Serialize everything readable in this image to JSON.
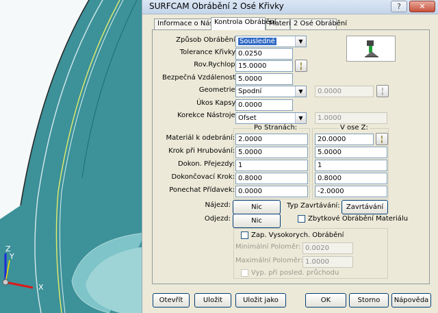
{
  "window": {
    "title": "SURFCAM Obrábění 2 Osé Křivky",
    "close_symbol": "✕",
    "help_symbol": "?"
  },
  "tabs": [
    {
      "label": "Informace o Nástroji"
    },
    {
      "label": "Kontrola Obrábění"
    },
    {
      "label": "Materiál"
    },
    {
      "label": "2 Osé Obrábění"
    }
  ],
  "form": {
    "zpusob": {
      "label": "Způsob Obrábění:",
      "value": "Sousledné"
    },
    "tolerance": {
      "label": "Tolerance Křivky:",
      "value": "0.0250"
    },
    "rov_rychlop": {
      "label": "Rov.Rychlop:",
      "value": "15.0000"
    },
    "bezpecna": {
      "label": "Bezpečná Vzdálenost:",
      "value": "5.0000"
    },
    "geometrie": {
      "label": "Geometrie:",
      "value": "Spodní",
      "side_value": "0.0000"
    },
    "ukos": {
      "label": "Úkos Kapsy:",
      "value": "0.0000"
    },
    "korekce": {
      "label": "Korekce Nástroje:",
      "value": "Ofset",
      "side_value": "1.0000"
    }
  },
  "grid": {
    "col1_title": "Po Stranách:",
    "col2_title": "V ose Z:",
    "rows": [
      {
        "label": "Materiál k odebrání:",
        "side": "2.0000",
        "z": "20.0000"
      },
      {
        "label": "Krok při Hrubování:",
        "side": "5.0000",
        "z": "5.0000"
      },
      {
        "label": "Dokon. Přejezdy:",
        "side": "1",
        "z": "1"
      },
      {
        "label": "Dokončovací Krok:",
        "side": "0.8000",
        "z": "0.8000"
      },
      {
        "label": "Ponechat Přídavek:",
        "side": "0.0000",
        "z": "-2.0000"
      }
    ]
  },
  "najezd": {
    "label": "Nájezd:",
    "button": "Nic"
  },
  "odjezd": {
    "label": "Odjezd:",
    "button": "Nic"
  },
  "typ_zavrtavani": {
    "label": "Typ Zavrtávání:",
    "button": "Zavrtávání"
  },
  "zbytkove": {
    "label": "Zbytkové Obrábění Materiálu"
  },
  "hsm": {
    "label": "Zap. Vysokorych. Obrábění",
    "min_label": "Minimální Poloměr:",
    "min_value": "0.0020",
    "max_label": "Maximální Poloměr:",
    "max_value": "1.0000",
    "posled_label": "Vyp. při posled. průchodu"
  },
  "footer": {
    "otevrit": "Otevřít",
    "ulozit": "Uložit",
    "ulozit_jako": "Uložit jako",
    "ok": "OK",
    "storno": "Storno",
    "napoveda": "Nápověda"
  },
  "axes": {
    "z": "Z",
    "y": "Y",
    "x": "X"
  },
  "colors": {
    "viewport": "#3b8f98",
    "selection": "#316ac5",
    "dialog_bg": "#ece9d8"
  }
}
